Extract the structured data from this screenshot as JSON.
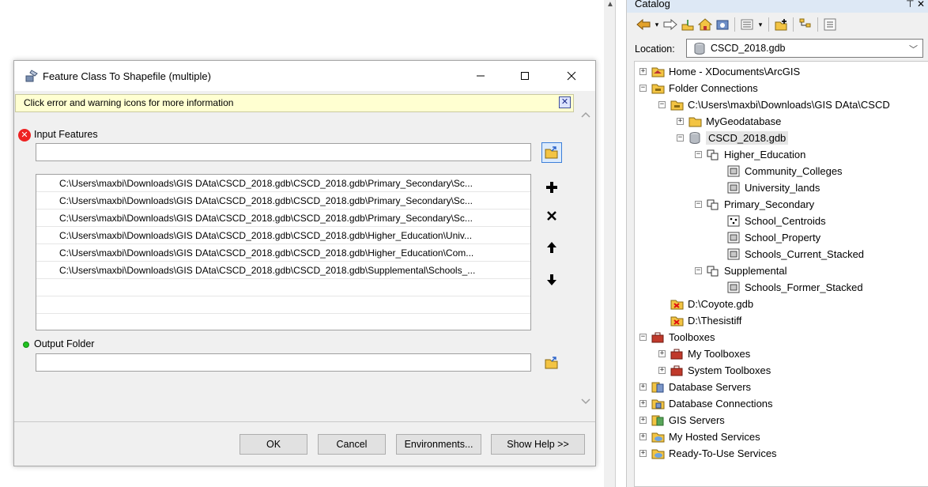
{
  "dialog": {
    "title": "Feature Class To Shapefile (multiple)",
    "message": "Click error and warning icons for more information",
    "input_label": "Input Features",
    "input_value": "",
    "input_rows": [
      "C:\\Users\\maxbi\\Downloads\\GIS DAta\\CSCD_2018.gdb\\CSCD_2018.gdb\\Primary_Secondary\\Sc...",
      "C:\\Users\\maxbi\\Downloads\\GIS DAta\\CSCD_2018.gdb\\CSCD_2018.gdb\\Primary_Secondary\\Sc...",
      "C:\\Users\\maxbi\\Downloads\\GIS DAta\\CSCD_2018.gdb\\CSCD_2018.gdb\\Primary_Secondary\\Sc...",
      "C:\\Users\\maxbi\\Downloads\\GIS DAta\\CSCD_2018.gdb\\CSCD_2018.gdb\\Higher_Education\\Univ...",
      "C:\\Users\\maxbi\\Downloads\\GIS DAta\\CSCD_2018.gdb\\CSCD_2018.gdb\\Higher_Education\\Com...",
      "C:\\Users\\maxbi\\Downloads\\GIS DAta\\CSCD_2018.gdb\\CSCD_2018.gdb\\Supplemental\\Schools_..."
    ],
    "output_label": "Output Folder",
    "output_value": "",
    "buttons": {
      "ok": "OK",
      "cancel": "Cancel",
      "environments": "Environments...",
      "show_help": "Show Help >>"
    }
  },
  "catalog": {
    "title": "Catalog",
    "location_label": "Location:",
    "location_value": "CSCD_2018.gdb",
    "tree": [
      {
        "label": "Home - XDocuments\\ArcGIS"
      },
      {
        "label": "Folder Connections"
      },
      {
        "label": "C:\\Users\\maxbi\\Downloads\\GIS DAta\\CSCD"
      },
      {
        "label": "MyGeodatabase"
      },
      {
        "label": "CSCD_2018.gdb"
      },
      {
        "label": "Higher_Education"
      },
      {
        "label": "Community_Colleges"
      },
      {
        "label": "University_lands"
      },
      {
        "label": "Primary_Secondary"
      },
      {
        "label": "School_Centroids"
      },
      {
        "label": "School_Property"
      },
      {
        "label": "Schools_Current_Stacked"
      },
      {
        "label": "Supplemental"
      },
      {
        "label": "Schools_Former_Stacked"
      },
      {
        "label": "D:\\Coyote.gdb"
      },
      {
        "label": "D:\\Thesistiff"
      },
      {
        "label": "Toolboxes"
      },
      {
        "label": "My Toolboxes"
      },
      {
        "label": "System Toolboxes"
      },
      {
        "label": "Database Servers"
      },
      {
        "label": "Database Connections"
      },
      {
        "label": "GIS Servers"
      },
      {
        "label": "My Hosted Services"
      },
      {
        "label": "Ready-To-Use Services"
      }
    ]
  },
  "colors": {
    "message_bg": "#ffffd1",
    "error": "#e22222",
    "ok": "#21c321",
    "folder": "#e8b531",
    "toolbox": "#c0392b"
  }
}
